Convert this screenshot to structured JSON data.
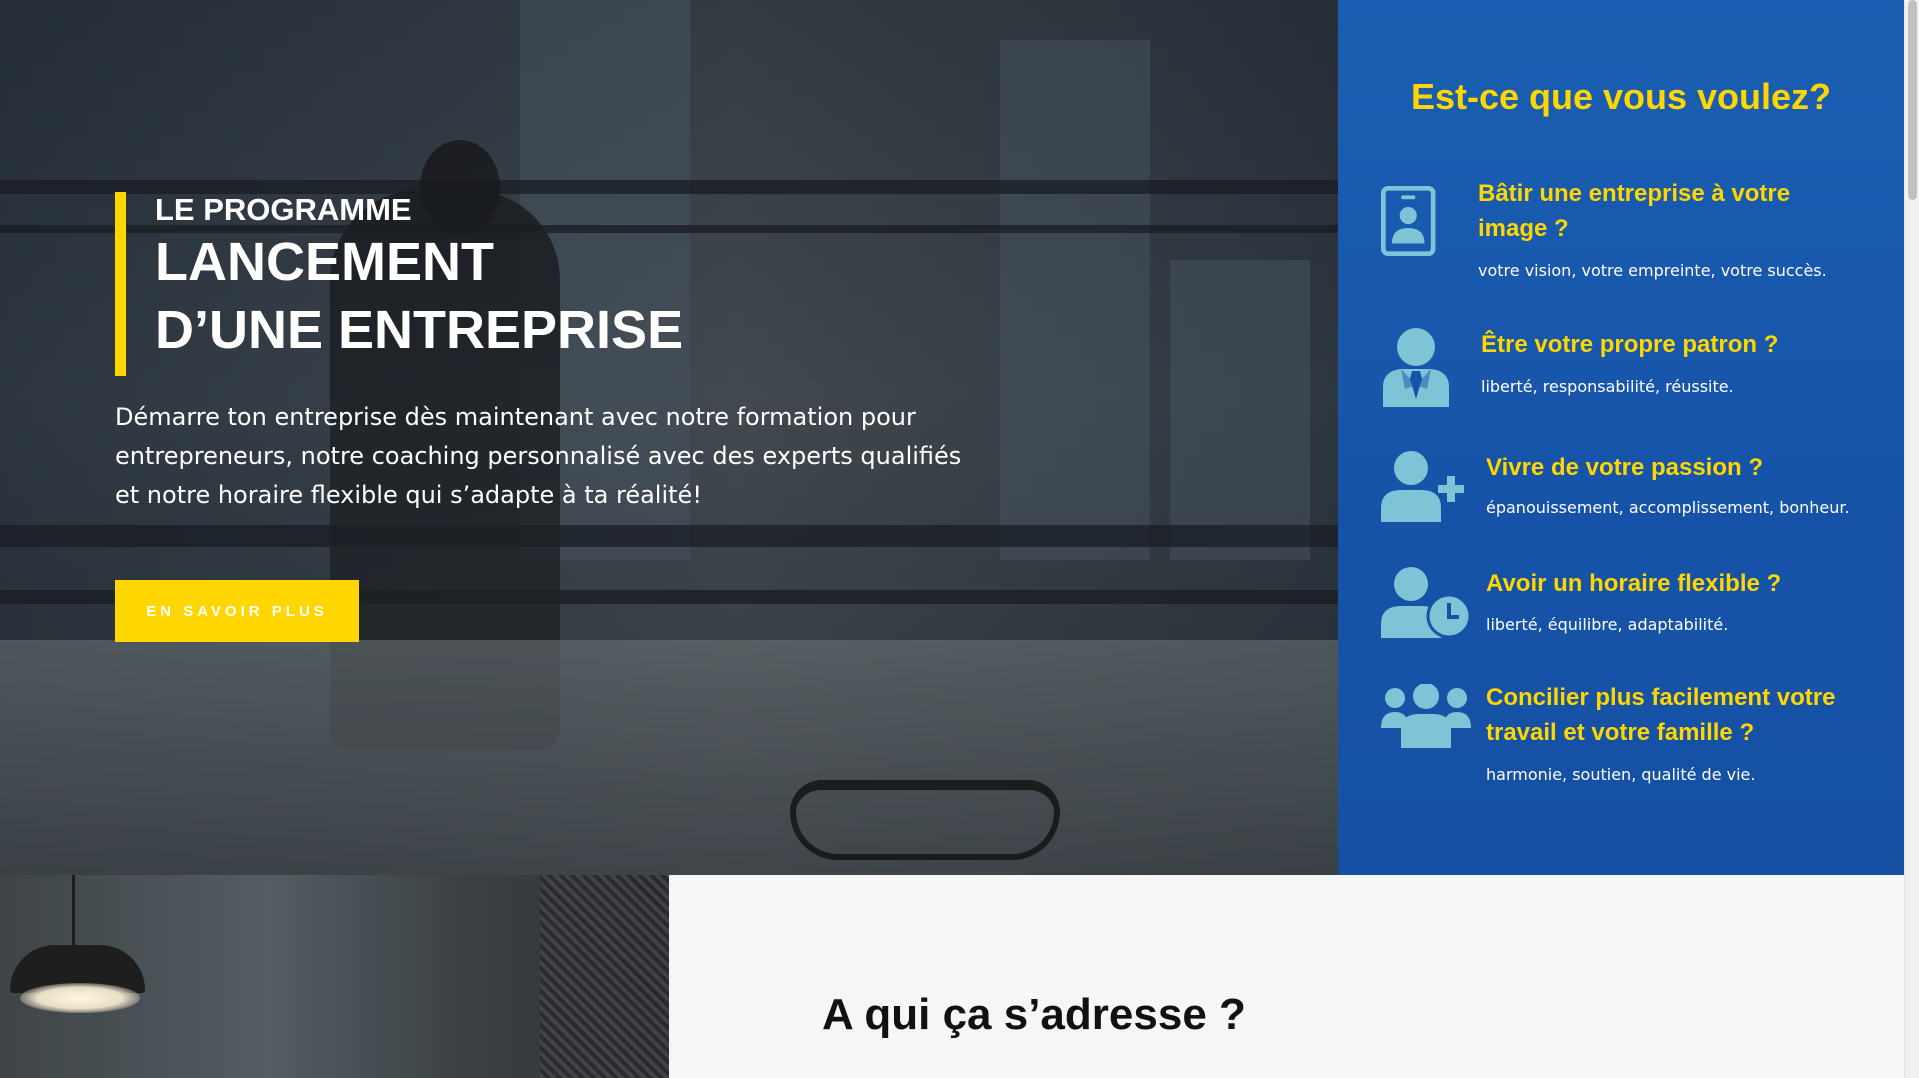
{
  "hero": {
    "kicker": "LE PROGRAMME",
    "title_line1": "LANCEMENT",
    "title_line2": "D’UNE ENTREPRISE",
    "text": "Démarre ton entreprise dès maintenant avec notre formation pour entrepreneurs, notre coaching personnalisé avec des experts qualifiés et notre horaire flexible qui s’adapte à ta réalité!",
    "cta_label": "EN SAVOIR PLUS"
  },
  "panel": {
    "title": "Est-ce que vous voulez?",
    "icon_color": "#7fc4d6",
    "features": [
      {
        "icon": "id-badge-icon",
        "title": "Bâtir une entreprise à votre image ?",
        "subtitle": "votre vision, votre empreinte, votre succès."
      },
      {
        "icon": "businessman-icon",
        "title": "Être votre propre patron ?",
        "subtitle": "liberté, responsabilité, réussite."
      },
      {
        "icon": "user-plus-icon",
        "title": "Vivre de votre passion ?",
        "subtitle": "épanouissement, accomplissement, bonheur."
      },
      {
        "icon": "user-clock-icon",
        "title": "Avoir un horaire flexible ?",
        "subtitle": "liberté, équilibre, adaptabilité."
      },
      {
        "icon": "users-group-icon",
        "title": "Concilier plus facilement votre travail et votre famille ?",
        "subtitle": "harmonie, soutien, qualité de vie."
      }
    ]
  },
  "lower": {
    "heading": "A qui ça s’adresse ?"
  },
  "colors": {
    "accent_yellow": "#ffd600",
    "panel_blue": "#1a5fb3",
    "icon_teal": "#7fc4d6"
  }
}
